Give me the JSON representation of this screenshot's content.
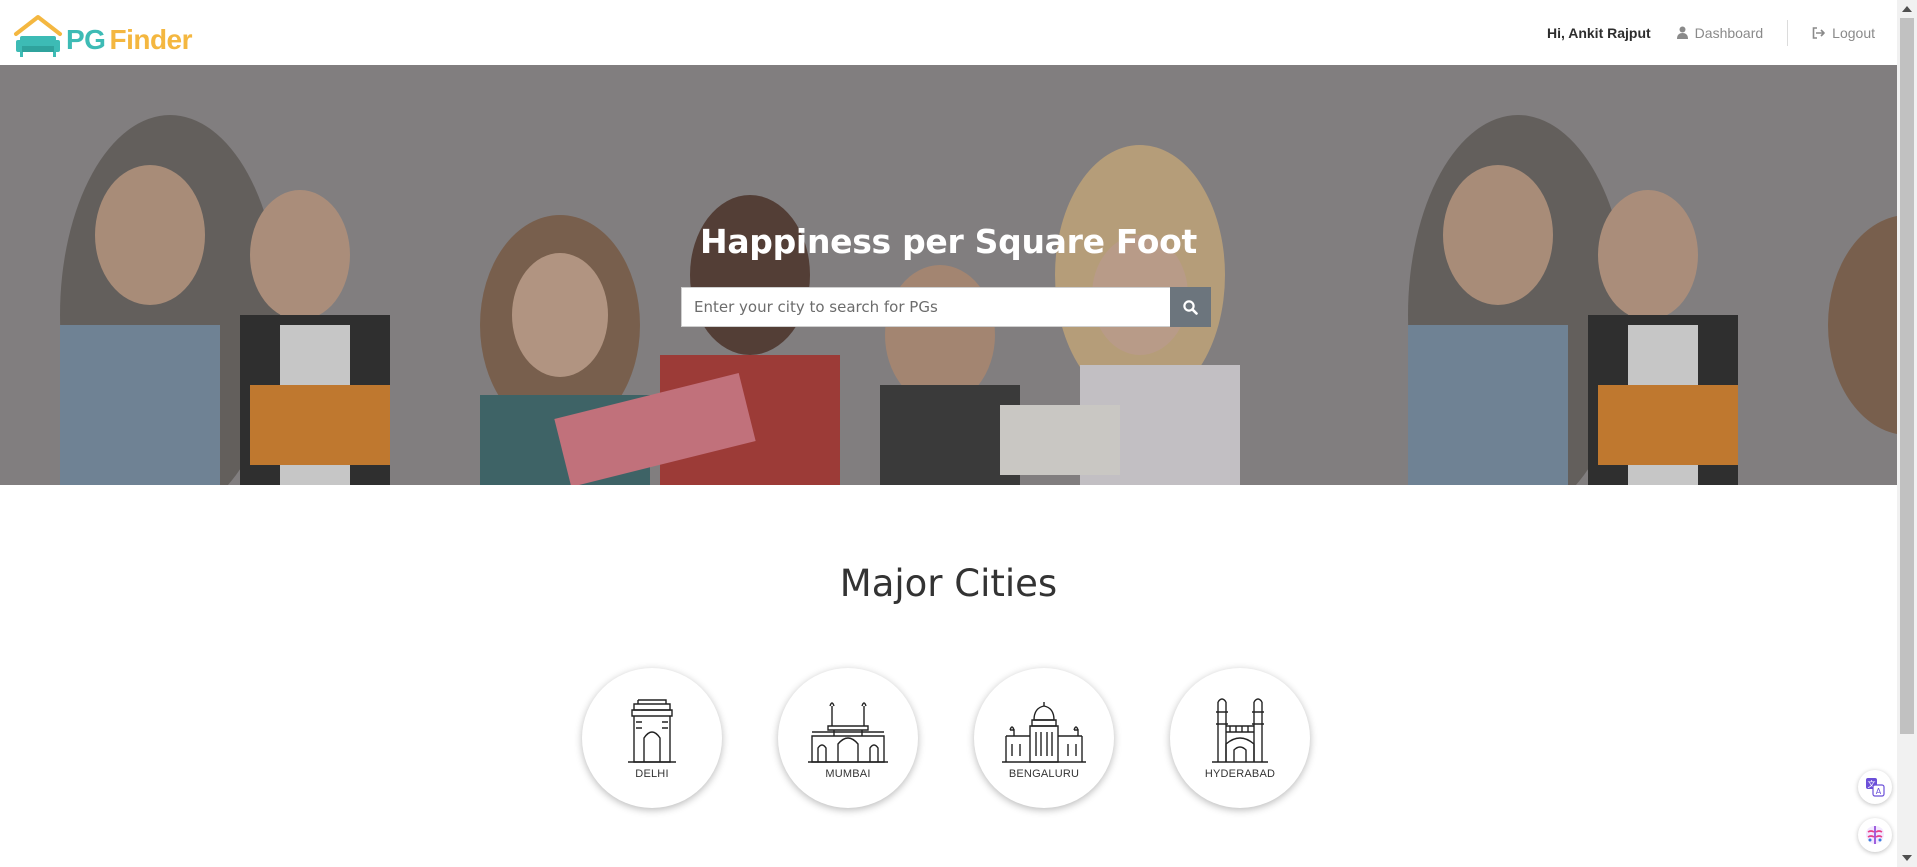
{
  "brand": {
    "part1": "PG",
    "part2": "Finder",
    "colors": {
      "teal": "#3dbbb5",
      "yellow": "#f4b740"
    }
  },
  "header": {
    "greeting": "Hi, Ankit Rajput",
    "dashboard_label": "Dashboard",
    "logout_label": "Logout",
    "icons": {
      "dashboard": "user-icon",
      "logout": "sign-out-icon"
    }
  },
  "hero": {
    "title": "Happiness per Square Foot",
    "search": {
      "placeholder": "Enter your city to search for PGs",
      "value": "",
      "button_icon": "search-icon",
      "button_color": "#6c757d"
    }
  },
  "cities_section": {
    "title": "Major Cities",
    "cities": [
      {
        "name": "DELHI",
        "icon": "india-gate-icon"
      },
      {
        "name": "MUMBAI",
        "icon": "gateway-of-india-icon"
      },
      {
        "name": "BENGALURU",
        "icon": "vidhana-soudha-icon"
      },
      {
        "name": "HYDERABAD",
        "icon": "charminar-icon"
      }
    ]
  }
}
